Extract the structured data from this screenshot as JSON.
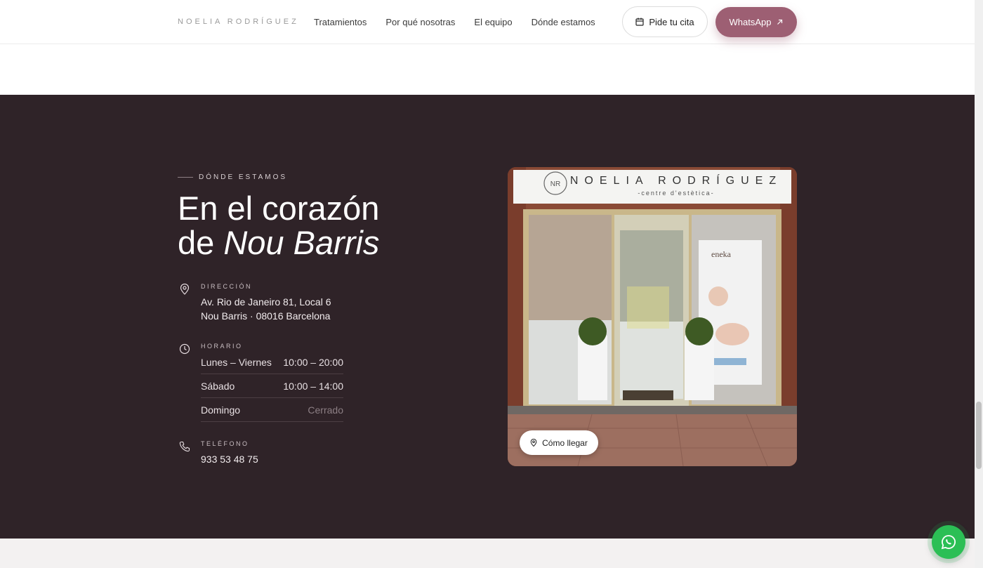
{
  "header": {
    "logo": "NOELIA RODRÍGUEZ",
    "nav": [
      "Tratamientos",
      "Por qué nosotras",
      "El equipo",
      "Dónde estamos"
    ],
    "cita_label": "Pide tu cita",
    "whatsapp_label": "WhatsApp"
  },
  "location": {
    "eyebrow": "DÓNDE ESTAMOS",
    "title_line1": "En el corazón",
    "title_line2_plain": "de",
    "title_line2_italic": "Nou Barris",
    "address_label": "DIRECCIÓN",
    "address_line1": "Av. Rio de Janeiro 81, Local 6",
    "address_line2": "Nou Barris · 08016 Barcelona",
    "hours_label": "HORARIO",
    "hours": [
      {
        "day": "Lunes – Viernes",
        "time": "10:00 – 20:00"
      },
      {
        "day": "Sábado",
        "time": "10:00 – 14:00"
      },
      {
        "day": "Domingo",
        "time": "Cerrado"
      }
    ],
    "phone_label": "TELÉFONO",
    "phone": "933 53 48 75",
    "directions_label": "Cómo llegar"
  },
  "photo": {
    "sign_brand": "NOELIA RODRÍGUEZ",
    "sign_sub": "-centre    d'estètica-",
    "sign_monogram": "NR",
    "poster_brand": "eneka"
  },
  "colors": {
    "section_bg": "#2f2328",
    "accent": "#9d5f73",
    "whatsapp_green": "#2bbf55"
  }
}
